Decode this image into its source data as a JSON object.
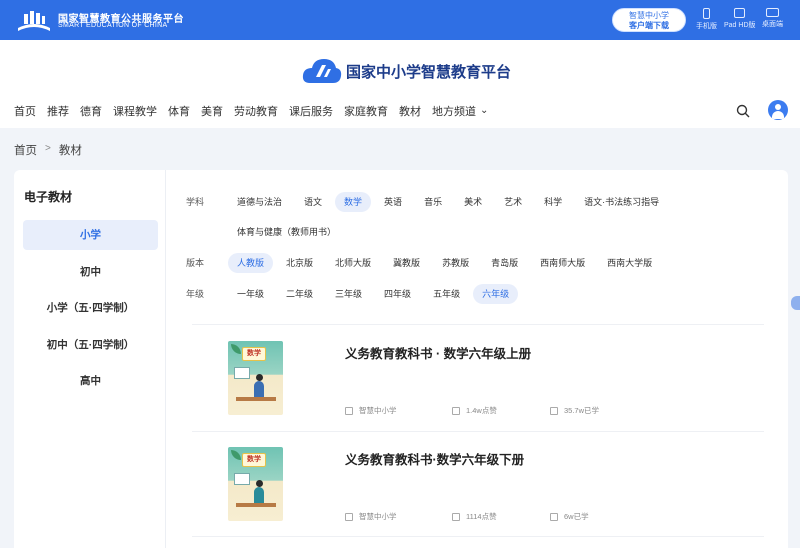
{
  "topbar": {
    "org_name_cn": "国家智慧教育公共服务平台",
    "org_name_en": "SMART EDUCATION OF CHINA",
    "client_btn_line1": "智慧中小学",
    "client_btn_line2": "客户端下载",
    "devices": [
      {
        "label": "手机版",
        "icon": "phone-icon"
      },
      {
        "label": "Pad HD版",
        "icon": "tablet-icon"
      },
      {
        "label": "桌面端",
        "icon": "desktop-icon"
      }
    ]
  },
  "header": {
    "brand_name": "国家中小学智慧教育平台",
    "nav": [
      "首页",
      "推荐",
      "德育",
      "课程教学",
      "体育",
      "美育",
      "劳动教育",
      "课后服务",
      "家庭教育",
      "教材",
      "地方频道"
    ]
  },
  "breadcrumb": {
    "home": "首页",
    "separator": ">",
    "current": "教材"
  },
  "sidebar": {
    "title": "电子教材",
    "items": [
      "小学",
      "初中",
      "小学（五·四学制）",
      "初中（五·四学制）",
      "高中"
    ],
    "active_index": 0
  },
  "filters": {
    "subject": {
      "label": "学科",
      "options": [
        "道德与法治",
        "语文",
        "数学",
        "英语",
        "音乐",
        "美术",
        "艺术",
        "科学",
        "语文·书法练习指导",
        "体育与健康（教师用书）"
      ],
      "active": "数学"
    },
    "edition": {
      "label": "版本",
      "options": [
        "人教版",
        "北京版",
        "北师大版",
        "冀教版",
        "苏教版",
        "青岛版",
        "西南师大版",
        "西南大学版"
      ],
      "active": "人教版"
    },
    "grade": {
      "label": "年级",
      "options": [
        "一年级",
        "二年级",
        "三年级",
        "四年级",
        "五年级",
        "六年级"
      ],
      "active": "六年级"
    }
  },
  "books": [
    {
      "title": "义务教育教科书 · 数学六年级上册",
      "cover_text": "数学",
      "publisher": "智慧中小学",
      "likes": "1.4w点赞",
      "learners": "35.7w已学"
    },
    {
      "title": "义务教育教科书·数学六年级下册",
      "cover_text": "数学",
      "publisher": "智慧中小学",
      "likes": "1114点赞",
      "learners": "6w已学"
    }
  ],
  "colors": {
    "primary": "#2f6fe4",
    "active_bg": "#e8eefb",
    "page_bg": "#f1f4f9",
    "brand_text": "#1d3c8a"
  }
}
